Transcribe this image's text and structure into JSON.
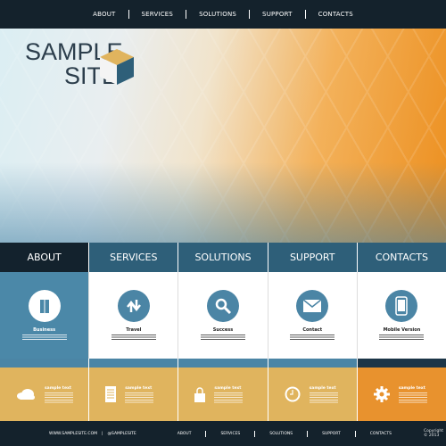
{
  "top_nav": [
    "ABOUT",
    "SERVICES",
    "SOLUTIONS",
    "SUPPORT",
    "CONTACTS"
  ],
  "logo": {
    "line1": "SAMPLE",
    "line2": "SITE"
  },
  "tabs": [
    "ABOUT",
    "SERVICES",
    "SOLUTIONS",
    "SUPPORT",
    "CONTACTS"
  ],
  "panels": [
    {
      "title": "Business",
      "icon": "book-icon"
    },
    {
      "title": "Travel",
      "icon": "arrows-icon"
    },
    {
      "title": "Success",
      "icon": "magnifier-icon"
    },
    {
      "title": "Contact",
      "icon": "envelope-icon"
    },
    {
      "title": "Mobile Version",
      "icon": "phone-icon"
    }
  ],
  "features": [
    {
      "title": "sample text",
      "icon": "cloud-icon"
    },
    {
      "title": "sample text",
      "icon": "document-icon"
    },
    {
      "title": "sample text",
      "icon": "lock-icon"
    },
    {
      "title": "sample text",
      "icon": "clock-icon"
    },
    {
      "title": "sample text",
      "icon": "gear-icon"
    }
  ],
  "footer": {
    "site": "WWW.SAMPLESITE.COM",
    "separator": "|",
    "handle": "@SAMPLESITE",
    "nav": [
      "ABOUT",
      "SERVICES",
      "SOLUTIONS",
      "SUPPORT",
      "CONTACTS"
    ],
    "copyright": "Copyright © 2013"
  },
  "colors": {
    "dark": "#14222c",
    "blue": "#2e5f79",
    "panel_blue": "#4b88a8",
    "yellow": "#e0b45e",
    "orange": "#e8922e"
  }
}
